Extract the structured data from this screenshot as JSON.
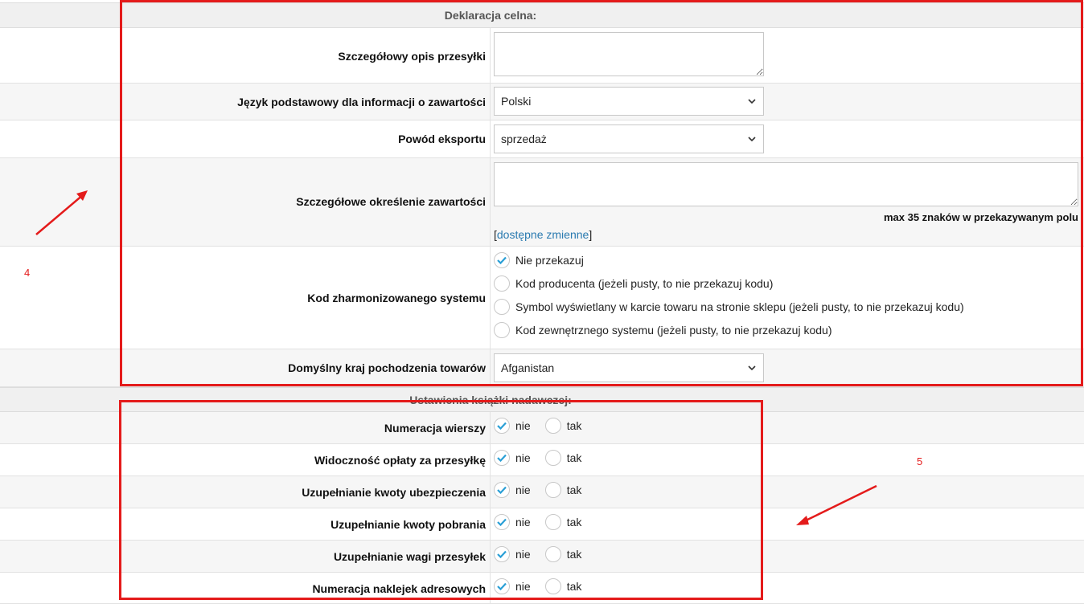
{
  "customs": {
    "section_title": "Deklaracja celna:",
    "desc_label": "Szczegółowy opis przesyłki",
    "desc_value": "",
    "lang_label": "Język podstawowy dla informacji o zawartości",
    "lang_value": "Polski",
    "reason_label": "Powód eksportu",
    "reason_value": "sprzedaż",
    "content_label": "Szczegółowe określenie zawartości",
    "content_value": "",
    "content_note": "max 35 znaków w przekazywanym polu",
    "vars_open": "[",
    "vars_link": "dostępne zmienne",
    "vars_close": "]",
    "hs_label": "Kod zharmonizowanego systemu",
    "hs_options": [
      {
        "label": "Nie przekazuj",
        "checked": true
      },
      {
        "label": "Kod producenta (jeżeli pusty, to nie przekazuj kodu)",
        "checked": false
      },
      {
        "label": "Symbol wyświetlany w karcie towaru na stronie sklepu (jeżeli pusty, to nie przekazuj kodu)",
        "checked": false
      },
      {
        "label": "Kod zewnętrznego systemu (jeżeli pusty, to nie przekazuj kodu)",
        "checked": false
      }
    ],
    "origin_label": "Domyślny kraj pochodzenia towarów",
    "origin_value": "Afganistan"
  },
  "book": {
    "section_title": "Ustawienia książki nadawczej:",
    "rows": [
      {
        "label": "Numeracja wierszy",
        "value": "nie"
      },
      {
        "label": "Widoczność opłaty za przesyłkę",
        "value": "nie"
      },
      {
        "label": "Uzupełnianie kwoty ubezpieczenia",
        "value": "nie"
      },
      {
        "label": "Uzupełnianie kwoty pobrania",
        "value": "nie"
      },
      {
        "label": "Uzupełnianie wagi przesyłek",
        "value": "nie"
      },
      {
        "label": "Numeracja naklejek adresowych",
        "value": "nie"
      }
    ],
    "no_label": "nie",
    "yes_label": "tak"
  },
  "annotations": {
    "marker_4": "4",
    "marker_5": "5",
    "color": "#e41b1b"
  },
  "colors": {
    "check": "#2a9fd6",
    "link": "#2a7ab0"
  }
}
